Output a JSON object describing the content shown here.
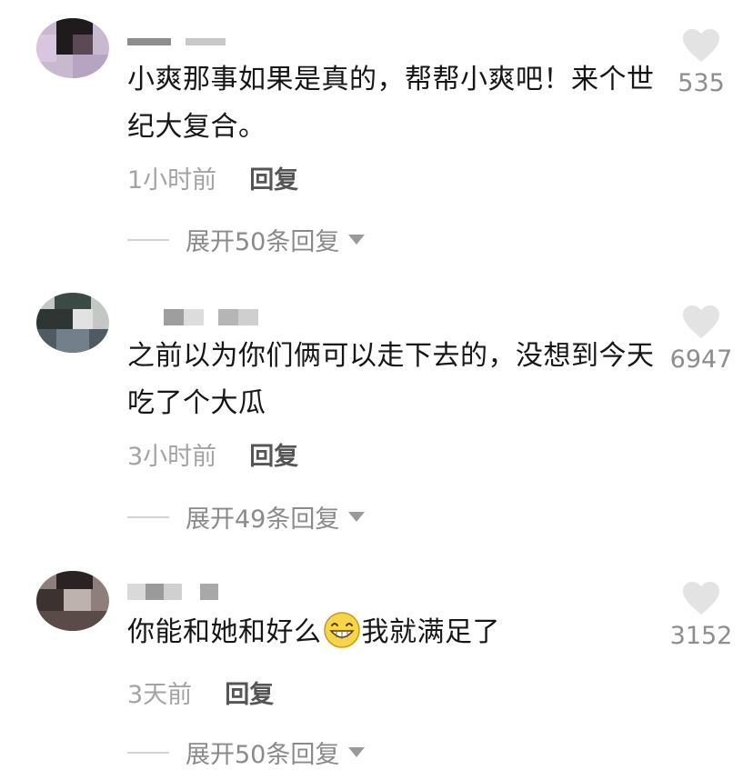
{
  "comments": [
    {
      "text": "小爽那事如果是真的，帮帮小爽吧！来个世纪大复合。",
      "time": "1小时前",
      "reply_label": "回复",
      "expand_label": "展开50条回复",
      "likes": "535"
    },
    {
      "text": "之前以为你们俩可以走下去的，没想到今天吃了个大瓜",
      "time": "3小时前",
      "reply_label": "回复",
      "expand_label": "展开49条回复",
      "likes": "6947"
    },
    {
      "text_before": "你能和她和好么",
      "text_after": "我就满足了",
      "emoji": "grin-emoji",
      "time": "3天前",
      "reply_label": "回复",
      "expand_label": "展开50条回复",
      "likes": "3152"
    }
  ],
  "colors": {
    "text": "#161616",
    "meta": "#a3a3a3",
    "reply": "#555555",
    "heart": "#e3e3e3",
    "like_count": "#8d8d8d"
  }
}
